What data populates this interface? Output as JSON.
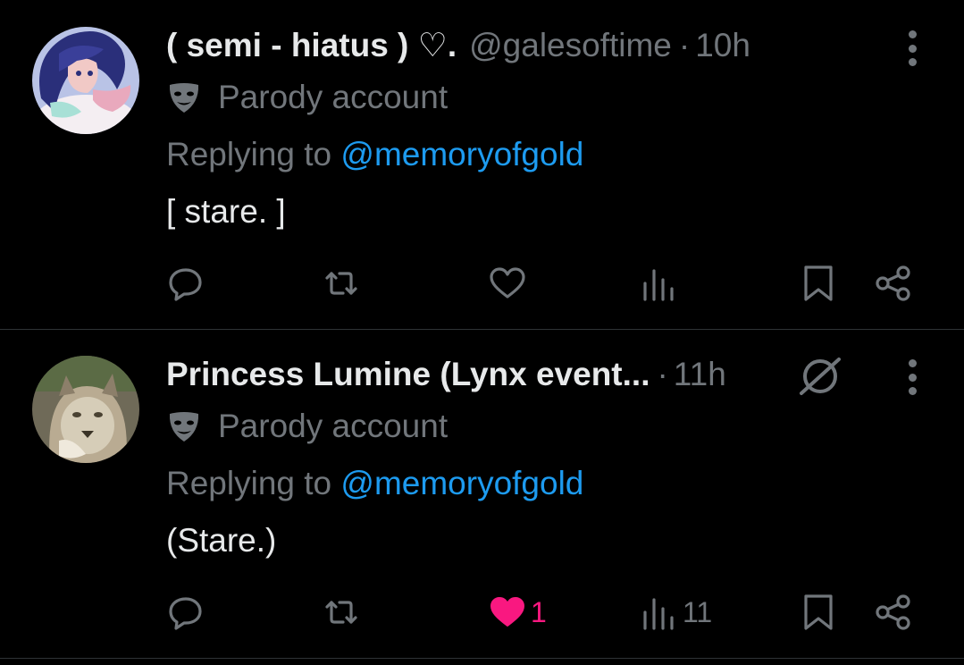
{
  "posts": [
    {
      "author_name": "( semi - hiatus ) ♡.",
      "handle": "@galesoftime",
      "separator": "·",
      "time": "10h",
      "parody_label": "Parody account",
      "replying_prefix": "Replying to",
      "replying_to": "@memoryofgold",
      "text": "[ stare. ]",
      "likes": "",
      "views": "",
      "liked": false
    },
    {
      "author_name": "Princess Lumine (Lynx event...",
      "handle": "",
      "separator": "·",
      "time": "11h",
      "parody_label": "Parody account",
      "replying_prefix": "Replying to",
      "replying_to": "@memoryofgold",
      "text": "(Stare.)",
      "likes": "1",
      "views": "11",
      "liked": true
    }
  ],
  "icons": {
    "reply": "reply-icon",
    "repost": "repost-icon",
    "like": "heart-icon",
    "views": "views-icon",
    "bookmark": "bookmark-icon",
    "share": "share-icon",
    "more": "more-icon",
    "grok": "grok-icon",
    "parody": "mask-icon"
  },
  "colors": {
    "background": "#000000",
    "text": "#e7e9ea",
    "muted": "#71767b",
    "link": "#1d9bf0",
    "like_active": "#f91880"
  }
}
